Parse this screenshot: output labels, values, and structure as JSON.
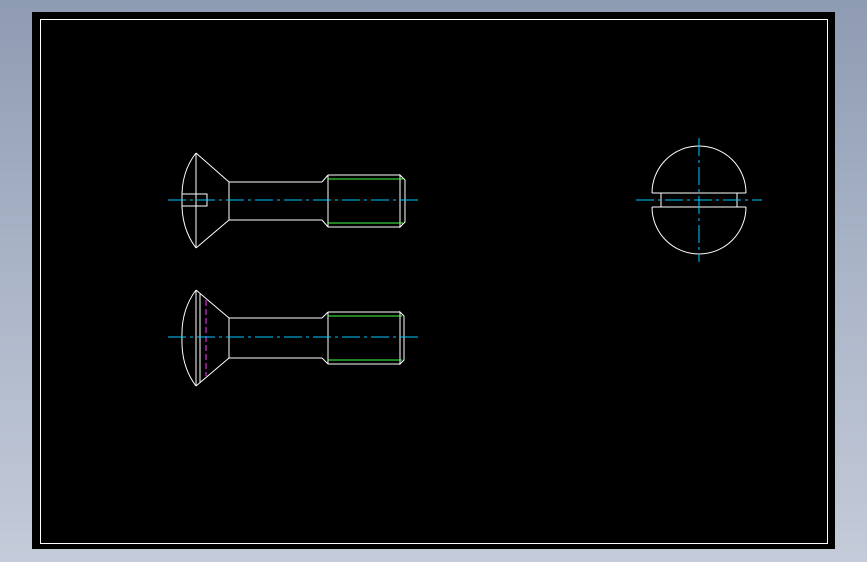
{
  "canvas": {
    "background_gradient_top": "#8e9bb2",
    "background_gradient_bottom": "#c4cbd9",
    "sheet_color": "#000000"
  },
  "colors": {
    "outline": "#ffffff",
    "centerline": "#00c8ff",
    "thread": "#44ff44",
    "hidden_edge": "#ff33ff"
  },
  "views": [
    {
      "name": "side-view-slotted"
    },
    {
      "name": "side-view-rotated"
    },
    {
      "name": "end-view-head"
    }
  ]
}
